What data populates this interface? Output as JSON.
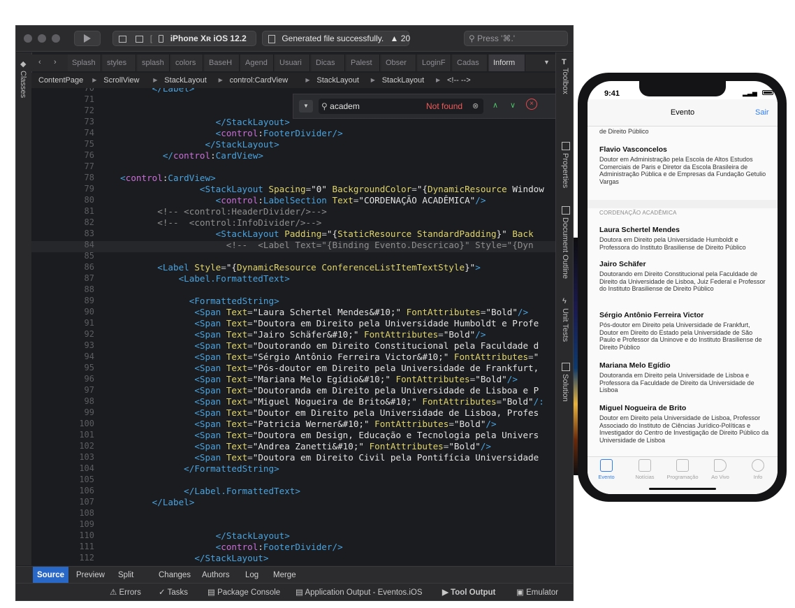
{
  "toolbar": {
    "run_icon": "play-icon",
    "device": "iPhone Xʀ iOS 12.2",
    "status_message": "Generated file successfully.",
    "warning_count": "20",
    "search_placeholder": "Press '⌘.'"
  },
  "tabs": [
    "Splash",
    "styles",
    "splash",
    "colors",
    "BaseH",
    "Agend",
    "Usuari",
    "Dicas",
    "Palest",
    "Obser",
    "LoginF",
    "Cadas",
    "Inform"
  ],
  "breadcrumbs": [
    "ContentPage",
    "ScrollView",
    "StackLayout",
    "control:CardView",
    "StackLayout",
    "StackLayout",
    "<!-- -->"
  ],
  "find": {
    "query": "academ",
    "status": "Not found"
  },
  "side_panels": {
    "left": "Classes",
    "right": [
      "Toolbox",
      "Properties",
      "Document Outline",
      "Unit Tests",
      "Solution"
    ]
  },
  "editor": {
    "lines": [
      {
        "n": "70",
        "h": [
          [
            "t",
            "        </"
          ],
          [
            "t",
            "Label"
          ],
          [
            "t",
            ">"
          ]
        ]
      },
      {
        "n": "71",
        "h": []
      },
      {
        "n": "72",
        "h": []
      },
      {
        "n": "73",
        "h": [
          [
            "t",
            "                    </"
          ],
          [
            "t",
            "StackLayout"
          ],
          [
            "t",
            ">"
          ]
        ]
      },
      {
        "n": "74",
        "h": [
          [
            "t",
            "                    <"
          ],
          [
            "n",
            "control"
          ],
          [
            "m",
            ":"
          ],
          [
            "t",
            "FooterDivider"
          ],
          [
            "t",
            "/>"
          ]
        ]
      },
      {
        "n": "75",
        "h": [
          [
            "t",
            "                  </"
          ],
          [
            "t",
            "StackLayout"
          ],
          [
            "t",
            ">"
          ]
        ]
      },
      {
        "n": "76",
        "h": [
          [
            "t",
            "          </"
          ],
          [
            "n",
            "control"
          ],
          [
            "m",
            ":"
          ],
          [
            "t",
            "CardView"
          ],
          [
            "t",
            ">"
          ]
        ]
      },
      {
        "n": "77",
        "h": []
      },
      {
        "n": "78",
        "h": [
          [
            "t",
            "  <"
          ],
          [
            "n",
            "control"
          ],
          [
            "m",
            ":"
          ],
          [
            "t",
            "CardView"
          ],
          [
            "t",
            ">"
          ]
        ]
      },
      {
        "n": "79",
        "h": [
          [
            "t",
            "                 <"
          ],
          [
            "t",
            "StackLayout "
          ],
          [
            "a",
            "Spacing"
          ],
          [
            "p",
            "="
          ],
          [
            "s",
            "\"0\""
          ],
          [
            "a",
            " BackgroundColor"
          ],
          [
            "p",
            "="
          ],
          [
            "s",
            "\"{"
          ],
          [
            "a",
            "DynamicResource"
          ],
          [
            "s",
            " Window"
          ]
        ]
      },
      {
        "n": "80",
        "h": [
          [
            "t",
            "                    <"
          ],
          [
            "n",
            "control"
          ],
          [
            "m",
            ":"
          ],
          [
            "t",
            "LabelSection "
          ],
          [
            "a",
            "Text"
          ],
          [
            "p",
            "="
          ],
          [
            "s",
            "\"CORDENAÇÃO ACADÊMICA\""
          ],
          [
            "t",
            "/>"
          ]
        ]
      },
      {
        "n": "81",
        "h": [
          [
            "c",
            "         <!-- <control:HeaderDivider/>-->"
          ]
        ]
      },
      {
        "n": "82",
        "h": [
          [
            "c",
            "         <!--  <control:InfoDivider/>-->"
          ]
        ]
      },
      {
        "n": "83",
        "h": [
          [
            "t",
            "                    <"
          ],
          [
            "t",
            "StackLayout "
          ],
          [
            "a",
            "Padding"
          ],
          [
            "p",
            "="
          ],
          [
            "s",
            "\"{"
          ],
          [
            "a",
            "StaticResource"
          ],
          [
            "a",
            " StandardPadding"
          ],
          [
            "s",
            "}\""
          ],
          [
            "a",
            " Back"
          ]
        ]
      },
      {
        "n": "84",
        "h": [
          [
            "c",
            "                      <!--  <Label Text=\"{Binding Evento.Descricao}\" Style=\"{Dyn"
          ]
        ]
      },
      {
        "n": "85",
        "h": []
      },
      {
        "n": "86",
        "h": [
          [
            "t",
            "         <"
          ],
          [
            "t",
            "Label "
          ],
          [
            "a",
            "Style"
          ],
          [
            "p",
            "="
          ],
          [
            "s",
            "\"{"
          ],
          [
            "a",
            "DynamicResource"
          ],
          [
            "a",
            " ConferenceListItemTextStyle"
          ],
          [
            "s",
            "}\""
          ],
          [
            "t",
            ">"
          ]
        ]
      },
      {
        "n": "87",
        "h": [
          [
            "t",
            "             <"
          ],
          [
            "t",
            "Label.FormattedText"
          ],
          [
            "t",
            ">"
          ]
        ]
      },
      {
        "n": "88",
        "h": []
      },
      {
        "n": "89",
        "h": [
          [
            "t",
            "               <"
          ],
          [
            "t",
            "FormattedString"
          ],
          [
            "t",
            ">"
          ]
        ]
      },
      {
        "n": "90",
        "h": [
          [
            "t",
            "                <"
          ],
          [
            "t",
            "Span "
          ],
          [
            "a",
            "Text"
          ],
          [
            "p",
            "="
          ],
          [
            "s",
            "\"Laura Schertel Mendes&#10;\""
          ],
          [
            "a",
            " FontAttributes"
          ],
          [
            "p",
            "="
          ],
          [
            "s",
            "\"Bold\""
          ],
          [
            "t",
            "/>"
          ]
        ]
      },
      {
        "n": "91",
        "h": [
          [
            "t",
            "                <"
          ],
          [
            "t",
            "Span "
          ],
          [
            "a",
            "Text"
          ],
          [
            "p",
            "="
          ],
          [
            "s",
            "\"Doutora em Direito pela Universidade Humboldt e Profe"
          ]
        ]
      },
      {
        "n": "92",
        "h": [
          [
            "t",
            "                <"
          ],
          [
            "t",
            "Span "
          ],
          [
            "a",
            "Text"
          ],
          [
            "p",
            "="
          ],
          [
            "s",
            "\"Jairo Schäfer&#10;\""
          ],
          [
            "a",
            " FontAttributes"
          ],
          [
            "p",
            "="
          ],
          [
            "s",
            "\"Bold\""
          ],
          [
            "t",
            "/>"
          ]
        ]
      },
      {
        "n": "93",
        "h": [
          [
            "t",
            "                <"
          ],
          [
            "t",
            "Span "
          ],
          [
            "a",
            "Text"
          ],
          [
            "p",
            "="
          ],
          [
            "s",
            "\"Doutorando em Direito Constitucional pela Faculdade d"
          ]
        ]
      },
      {
        "n": "94",
        "h": [
          [
            "t",
            "                <"
          ],
          [
            "t",
            "Span "
          ],
          [
            "a",
            "Text"
          ],
          [
            "p",
            "="
          ],
          [
            "s",
            "\"Sérgio Antônio Ferreira Victor&#10;\""
          ],
          [
            "a",
            " FontAttributes"
          ],
          [
            "p",
            "="
          ],
          [
            "s",
            "\""
          ]
        ]
      },
      {
        "n": "95",
        "h": [
          [
            "t",
            "                <"
          ],
          [
            "t",
            "Span "
          ],
          [
            "a",
            "Text"
          ],
          [
            "p",
            "="
          ],
          [
            "s",
            "\"Pós-doutor em Direito pela Universidade de Frankfurt,"
          ]
        ]
      },
      {
        "n": "96",
        "h": [
          [
            "t",
            "                <"
          ],
          [
            "t",
            "Span "
          ],
          [
            "a",
            "Text"
          ],
          [
            "p",
            "="
          ],
          [
            "s",
            "\"Mariana Melo Egídio&#10;\""
          ],
          [
            "a",
            " FontAttributes"
          ],
          [
            "p",
            "="
          ],
          [
            "s",
            "\"Bold\""
          ],
          [
            "t",
            "/>"
          ]
        ]
      },
      {
        "n": "97",
        "h": [
          [
            "t",
            "                <"
          ],
          [
            "t",
            "Span "
          ],
          [
            "a",
            "Text"
          ],
          [
            "p",
            "="
          ],
          [
            "s",
            "\"Doutoranda em Direito pela Universidade de Lisboa e P"
          ]
        ]
      },
      {
        "n": "98",
        "h": [
          [
            "t",
            "                <"
          ],
          [
            "t",
            "Span "
          ],
          [
            "a",
            "Text"
          ],
          [
            "p",
            "="
          ],
          [
            "s",
            "\"Miguel Nogueira de Brito&#10;\""
          ],
          [
            "a",
            " FontAttributes"
          ],
          [
            "p",
            "="
          ],
          [
            "s",
            "\"Bold\""
          ],
          [
            "t",
            "/:"
          ]
        ]
      },
      {
        "n": "99",
        "h": [
          [
            "t",
            "                <"
          ],
          [
            "t",
            "Span "
          ],
          [
            "a",
            "Text"
          ],
          [
            "p",
            "="
          ],
          [
            "s",
            "\"Doutor em Direito pela Universidade de Lisboa, Profes"
          ]
        ]
      },
      {
        "n": "100",
        "h": [
          [
            "t",
            "                <"
          ],
          [
            "t",
            "Span "
          ],
          [
            "a",
            "Text"
          ],
          [
            "p",
            "="
          ],
          [
            "s",
            "\"Patricia Werner&#10;\""
          ],
          [
            "a",
            " FontAttributes"
          ],
          [
            "p",
            "="
          ],
          [
            "s",
            "\"Bold\""
          ],
          [
            "t",
            "/>"
          ]
        ]
      },
      {
        "n": "101",
        "h": [
          [
            "t",
            "                <"
          ],
          [
            "t",
            "Span "
          ],
          [
            "a",
            "Text"
          ],
          [
            "p",
            "="
          ],
          [
            "s",
            "\"Doutora em Design, Educação e Tecnologia pela Univers"
          ]
        ]
      },
      {
        "n": "102",
        "h": [
          [
            "t",
            "                <"
          ],
          [
            "t",
            "Span "
          ],
          [
            "a",
            "Text"
          ],
          [
            "p",
            "="
          ],
          [
            "s",
            "\"Andrea Zanetti&#10;\""
          ],
          [
            "a",
            " FontAttributes"
          ],
          [
            "p",
            "="
          ],
          [
            "s",
            "\"Bold\""
          ],
          [
            "t",
            "/>"
          ]
        ]
      },
      {
        "n": "103",
        "h": [
          [
            "t",
            "                <"
          ],
          [
            "t",
            "Span "
          ],
          [
            "a",
            "Text"
          ],
          [
            "p",
            "="
          ],
          [
            "s",
            "\"Doutora em Direito Civil pela Pontifícia Universidade"
          ]
        ]
      },
      {
        "n": "104",
        "h": [
          [
            "t",
            "              </"
          ],
          [
            "t",
            "FormattedString"
          ],
          [
            "t",
            ">"
          ]
        ]
      },
      {
        "n": "105",
        "h": []
      },
      {
        "n": "106",
        "h": [
          [
            "t",
            "              </"
          ],
          [
            "t",
            "Label.FormattedText"
          ],
          [
            "t",
            ">"
          ]
        ]
      },
      {
        "n": "107",
        "h": [
          [
            "t",
            "        </"
          ],
          [
            "t",
            "Label"
          ],
          [
            "t",
            ">"
          ]
        ]
      },
      {
        "n": "108",
        "h": []
      },
      {
        "n": "109",
        "h": []
      },
      {
        "n": "110",
        "h": [
          [
            "t",
            "                    </"
          ],
          [
            "t",
            "StackLayout"
          ],
          [
            "t",
            ">"
          ]
        ]
      },
      {
        "n": "111",
        "h": [
          [
            "t",
            "                    <"
          ],
          [
            "n",
            "control"
          ],
          [
            "m",
            ":"
          ],
          [
            "t",
            "FooterDivider"
          ],
          [
            "t",
            "/>"
          ]
        ]
      },
      {
        "n": "112",
        "h": [
          [
            "t",
            "                </"
          ],
          [
            "t",
            "StackLayout"
          ],
          [
            "t",
            ">"
          ]
        ]
      }
    ]
  },
  "bottom_tabs": [
    "Source",
    "Preview",
    "Split",
    "Changes",
    "Authors",
    "Log",
    "Merge"
  ],
  "status_bar": [
    "Errors",
    "Tasks",
    "Package Console",
    "Application Output - Eventos.iOS",
    "Tool Output",
    "Emulator"
  ],
  "phone": {
    "time": "9:41",
    "nav_title": "Evento",
    "nav_action": "Sair",
    "partial_line": "de Direito Público",
    "first_person": {
      "name": "Flavio Vasconcelos",
      "desc": "Doutor em Administração pela Escola de Altos Estudos Comerciais de Paris e Diretor da Escola Brasileira de Administração Pública e de Empresas da Fundação Getulio Vargas"
    },
    "section_header": "CORDENAÇÃO ACADÊMICA",
    "people": [
      {
        "name": "Laura Schertel Mendes",
        "desc": "Doutora em Direito pela Universidade Humboldt e Professora do Instituto Brasiliense de Direito Público"
      },
      {
        "name": "Jairo Schäfer",
        "desc": "Doutorando em Direito Constitucional pela Faculdade de Direito da Universidade de Lisboa, Juiz Federal e Professor do Instituto Brasiliense de Direito Público"
      },
      {
        "name": "Sérgio Antônio Ferreira Victor",
        "desc": "Pós-doutor em Direito pela Universidade de Frankfurt, Doutor em Direito do Estado pela Universidade de São Paulo e Professor da Uninove e do Instituto Brasiliense de Direito Público"
      },
      {
        "name": "Mariana Melo Egídio",
        "desc": "Doutoranda em Direito pela Universidade de Lisboa e Professora da Faculdade de Direito da Universidade de Lisboa"
      },
      {
        "name": "Miguel Nogueira de Brito",
        "desc": "Doutor em Direito pela Universidade de Lisboa, Professor Associado do Instituto de Ciências Jurídico-Políticas e Investigador do Centro de Investigação de Direito Público da Universidade de Lisboa"
      }
    ],
    "tabbar": [
      "Evento",
      "Notícias",
      "Programação",
      "Ao Vivo",
      "Info"
    ],
    "tint_color": "#2f7df6"
  }
}
